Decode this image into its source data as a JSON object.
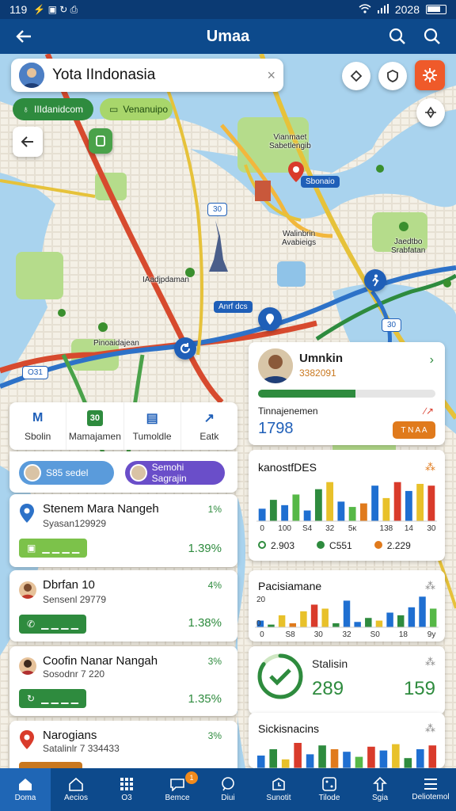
{
  "status": {
    "time": "119",
    "icons": "⚡ ▣ ↻ ⎙",
    "carrier": "2028"
  },
  "appbar": {
    "title": "Umaa"
  },
  "search": {
    "value": "Yota IIndonasia"
  },
  "chips": [
    {
      "label": "IIIdanidcom"
    },
    {
      "label": "Venanuipo"
    }
  ],
  "map_labels": {
    "l1": "Vianmaet\nSabetlengib",
    "l2": "Walinbrin\nAvabieigs",
    "l3": "IAadjpdaman",
    "l4": "Pinoaidajean",
    "l5": "Jaedtbo\nSrabfatan",
    "pin1": "Sbonaio",
    "pin2": "Anrf dcs",
    "pin3": "30",
    "pin4": "30",
    "pin5": "O31"
  },
  "tabs": [
    {
      "icon": "M",
      "label": "Sbolin"
    },
    {
      "icon": "30",
      "label": "Mamajamen"
    },
    {
      "icon": "▤",
      "label": "Tumoldle"
    },
    {
      "icon": "↗",
      "label": "Eatk"
    }
  ],
  "user_pills": [
    {
      "label": "S85 sedel"
    },
    {
      "label": "Semohi Sagrajin"
    }
  ],
  "list": [
    {
      "name": "Stenem Mara Nangeh",
      "sub": "Syasan129929",
      "pct": "1%",
      "value": "1.39%",
      "action": "▁ ▁ ▁ ▁",
      "color": "#7cc24a"
    },
    {
      "name": "Dbrfan 10",
      "sub": "Sensenl 29779",
      "pct": "4%",
      "value": "1.38%",
      "action": "▁ ▁ ▁ ▁",
      "color": "#2e8b3e"
    },
    {
      "name": "Coofin Nanar Nangah",
      "sub": "Sosodnr 7 220",
      "pct": "3%",
      "value": "1.35%",
      "action": "▁ ▁ ▁ ▁",
      "color": "#2e8b3e"
    },
    {
      "name": "Narogians",
      "sub": "Satalinlr 7 334433",
      "pct": "3%",
      "value": "",
      "action": "",
      "color": "#c9781f"
    }
  ],
  "profile_card": {
    "name": "Umnkin",
    "id": "3382091",
    "label": "Tinnajenemen",
    "progress": 0.55,
    "metric": "1798",
    "button": "T N A A",
    "mini": "∕↗"
  },
  "chart1": {
    "title": "kanostfDES",
    "legend": [
      {
        "value": "2.903",
        "color": "#2e8b3e"
      },
      {
        "value": "C551",
        "color": "#2e8b3e"
      },
      {
        "value": "2.229",
        "color": "#e07a1c"
      }
    ]
  },
  "chart_data": [
    {
      "type": "bar",
      "title": "kanostfDES",
      "categories": [
        "0",
        "",
        "100",
        "",
        "S4",
        "",
        "32",
        "",
        "5ĸ",
        "",
        "",
        "138",
        "",
        "14",
        "",
        "30"
      ],
      "series": [
        {
          "values": [
            14,
            24,
            18,
            30,
            12,
            36,
            44,
            22,
            16,
            20,
            40,
            26,
            44,
            34,
            42,
            40
          ]
        }
      ],
      "colors": [
        "#1f6fd1",
        "#2e8b3e",
        "#1f6fd1",
        "#56b847",
        "#1f6fd1",
        "#2e8b3e",
        "#e8c12a",
        "#1f6fd1",
        "#56b847",
        "#e07a1c",
        "#1f6fd1",
        "#e8c12a",
        "#d93b2b",
        "#1f6fd1",
        "#e8c12a",
        "#d93b2b"
      ],
      "ylim": [
        0,
        50
      ]
    },
    {
      "type": "bar",
      "title": "Pacisiamane",
      "categories": [
        "0",
        "",
        "S8",
        "",
        "30",
        "",
        "32",
        "",
        "S0",
        "",
        "18",
        "",
        "9y"
      ],
      "yticks": [
        "20",
        "0"
      ],
      "series": [
        {
          "values": [
            10,
            4,
            18,
            6,
            24,
            34,
            28,
            6,
            40,
            8,
            14,
            10,
            22,
            18,
            30,
            46,
            28
          ]
        }
      ],
      "colors": [
        "#1f6fd1",
        "#2e8b3e",
        "#e8c12a",
        "#e07a1c",
        "#e8c12a",
        "#d93b2b",
        "#e8c12a",
        "#2e8b3e",
        "#1f6fd1",
        "#1f6fd1",
        "#2e8b3e",
        "#e8c12a",
        "#1f6fd1",
        "#2e8b3e",
        "#1f6fd1",
        "#1f6fd1",
        "#56b847"
      ],
      "ylim": [
        0,
        50
      ]
    },
    {
      "type": "bar",
      "title": "Sickisnacins",
      "series": [
        {
          "values": [
            20,
            30,
            14,
            40,
            22,
            36,
            30,
            26,
            18,
            34,
            28,
            38,
            16,
            30,
            36
          ]
        }
      ],
      "colors": [
        "#1f6fd1",
        "#2e8b3e",
        "#e8c12a",
        "#d93b2b",
        "#1f6fd1",
        "#2e8b3e",
        "#e07a1c",
        "#1f6fd1",
        "#56b847",
        "#d93b2b",
        "#1f6fd1",
        "#e8c12a",
        "#2e8b3e",
        "#1f6fd1",
        "#d93b2b"
      ],
      "ylim": [
        0,
        50
      ]
    }
  ],
  "status_card": {
    "title": "Stalisin",
    "value_left": "289",
    "value_right": "159",
    "progress": 0.85
  },
  "chart2": {
    "title": "Pacisiamane"
  },
  "chart3": {
    "title": "Sickisnacins"
  },
  "colors": {
    "appbar": "#0d4a8c",
    "accent_green": "#2e8b3e",
    "accent_orange": "#e07a1c",
    "accent_red": "#d93b2b"
  },
  "bottom_nav": [
    {
      "icon": "home-icon",
      "label": "Doma"
    },
    {
      "icon": "house-icon",
      "label": "Aecios"
    },
    {
      "icon": "grid-icon",
      "label": "O3"
    },
    {
      "icon": "chat-icon",
      "label": "Bemce",
      "badge": "1"
    },
    {
      "icon": "bubble-icon",
      "label": "Diui"
    },
    {
      "icon": "clock-icon",
      "label": "Sunotit"
    },
    {
      "icon": "dice-icon",
      "label": "Tilode"
    },
    {
      "icon": "sign-icon",
      "label": "Sgia"
    },
    {
      "icon": "menu-icon",
      "label": "Deliotemol"
    }
  ]
}
